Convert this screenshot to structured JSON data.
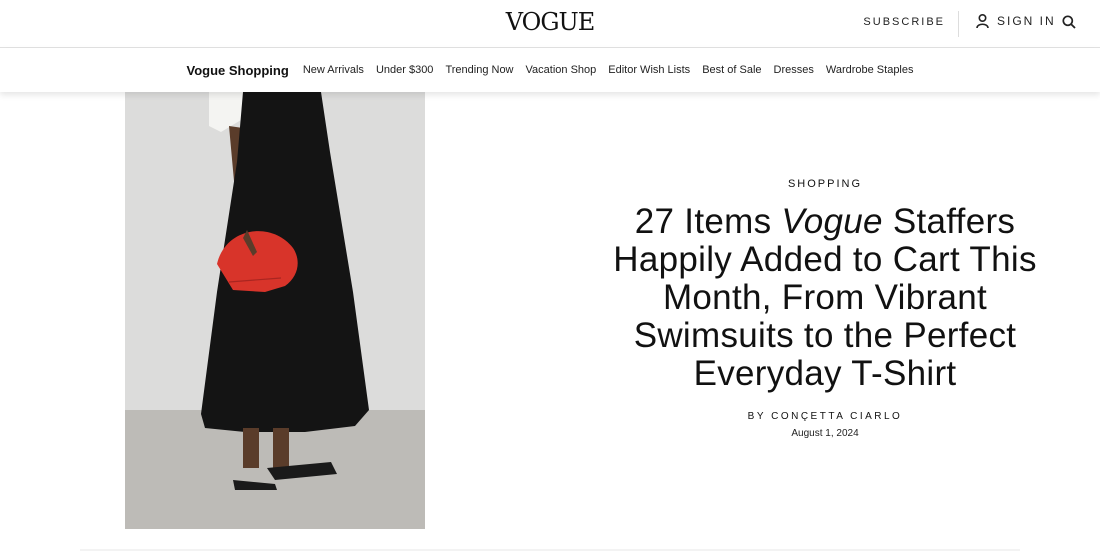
{
  "header": {
    "logo": "VOGUE",
    "subscribe": "SUBSCRIBE",
    "sign_in": "SIGN IN"
  },
  "nav": {
    "brand": "Vogue Shopping",
    "items": [
      "New Arrivals",
      "Under $300",
      "Trending Now",
      "Vacation Shop",
      "Editor Wish Lists",
      "Best of Sale",
      "Dresses",
      "Wardrobe Staples"
    ]
  },
  "article": {
    "kicker": "SHOPPING",
    "headline_part1": "27 Items ",
    "headline_emphasis": "Vogue",
    "headline_part2": " Staffers Happily Added to Cart This Month, From Vibrant Swimsuits to the Perfect Everyday T-Shirt",
    "byline": "BY CONÇETTA CIARLO",
    "date": "August 1, 2024"
  },
  "colors": {
    "bag": "#d8342a",
    "dress": "#151515",
    "background": "#d9d9d8",
    "floor": "#b9b7b3"
  }
}
